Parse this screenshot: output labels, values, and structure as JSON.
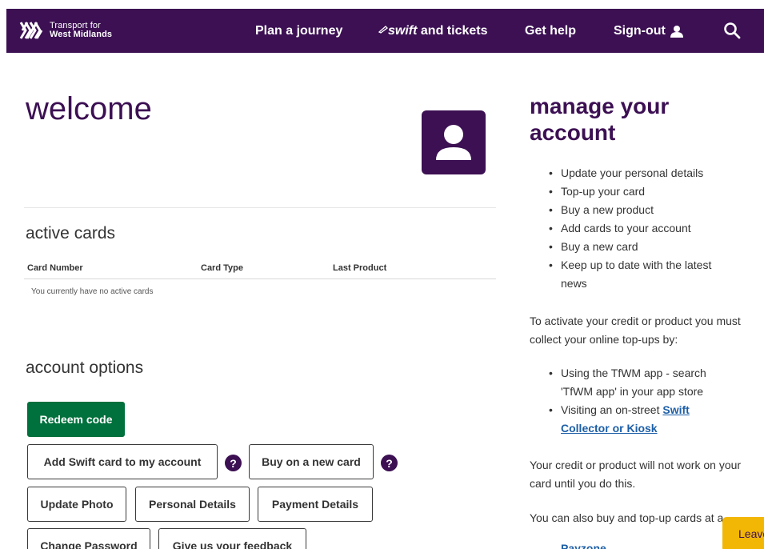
{
  "header": {
    "logo_line1": "Transport for",
    "logo_line2": "West Midlands",
    "nav": {
      "plan": "Plan a journey",
      "swift_brand": "swift",
      "swift_rest": " and tickets",
      "help": "Get help",
      "signout": "Sign-out"
    },
    "icons": {
      "search": "search-icon",
      "user": "user-icon",
      "logo": "tfwm-logo"
    }
  },
  "main": {
    "welcome": "welcome",
    "active_cards": {
      "title": "active cards",
      "columns": [
        "Card Number",
        "Card Type",
        "Last Product"
      ],
      "empty_message": "You currently have no active cards"
    },
    "account_options": {
      "title": "account options",
      "redeem": "Redeem code",
      "add_swift": "Add Swift card to my account",
      "buy_new": "Buy on a new card",
      "update_photo": "Update Photo",
      "personal_details": "Personal Details",
      "payment_details": "Payment Details",
      "change_password": "Change Password",
      "feedback": "Give us your feedback",
      "help_glyph": "?"
    }
  },
  "sidebar": {
    "title": "manage your account",
    "list1": [
      "Update your personal details",
      "Top-up your card",
      "Buy a new product",
      "Add cards to your account",
      "Buy a new card",
      "Keep up to date with the latest news"
    ],
    "para1": "To activate your credit or product you must collect your online top-ups by:",
    "list2_item1": "Using the TfWM app - search 'TfWM app' in your app store",
    "list2_item2_prefix": "Visiting an on-street ",
    "list2_item2_link": "Swift Collector or Kiosk",
    "para2": "Your credit or product will not work on your card until you do this.",
    "para3": "You can also buy and top-up cards at a",
    "peek_link": "Payzone Outlet"
  },
  "leave_tab": "Leave",
  "colors": {
    "brand_purple": "#3c1053",
    "green": "#00703c",
    "link_blue": "#1d5fa7",
    "yellow": "#f2b705"
  }
}
